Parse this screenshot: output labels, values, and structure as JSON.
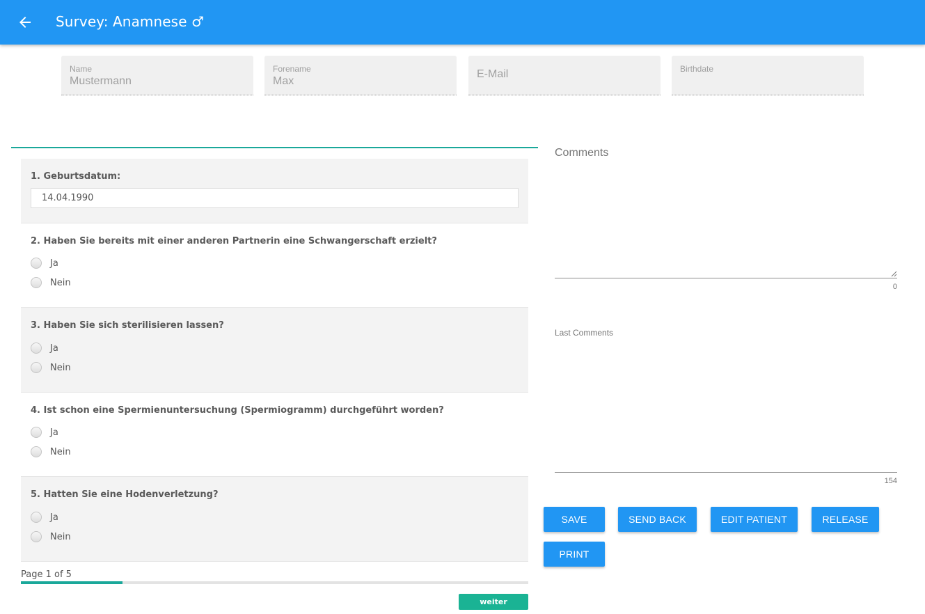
{
  "appbar": {
    "title": "Survey: Anamnese ♂",
    "back_icon": "arrow-left-icon",
    "color": "#2196f3"
  },
  "patient": {
    "name_label": "Name",
    "name_value": "Mustermann",
    "forename_label": "Forename",
    "forename_value": "Max",
    "email_placeholder": "E-Mail",
    "birthdate_label": "Birthdate"
  },
  "survey": {
    "questions": [
      {
        "title": "1. Geburtsdatum:",
        "type": "text",
        "value": "14.04.1990"
      },
      {
        "title": "2. Haben Sie bereits mit einer anderen Partnerin eine Schwangerschaft erzielt?",
        "type": "radio",
        "options": [
          "Ja",
          "Nein"
        ]
      },
      {
        "title": "3. Haben Sie sich sterilisieren lassen?",
        "type": "radio",
        "options": [
          "Ja",
          "Nein"
        ]
      },
      {
        "title": "4. Ist schon eine Spermienuntersuchung (Spermiogramm) durchgeführt worden?",
        "type": "radio",
        "options": [
          "Ja",
          "Nein"
        ]
      },
      {
        "title": "5. Hatten Sie eine Hodenverletzung?",
        "type": "radio",
        "options": [
          "Ja",
          "Nein"
        ]
      }
    ],
    "page_info": "Page 1 of 5",
    "progress": 0.2,
    "next_label": "weiter",
    "accent": "#1aa89a"
  },
  "comments": {
    "label": "Comments",
    "count": "0",
    "last_label": "Last Comments",
    "last_count": "154"
  },
  "actions": {
    "save": "SAVE",
    "send_back": "SEND BACK",
    "edit_patient": "EDIT PATIENT",
    "release": "RELEASE",
    "print": "PRINT"
  }
}
